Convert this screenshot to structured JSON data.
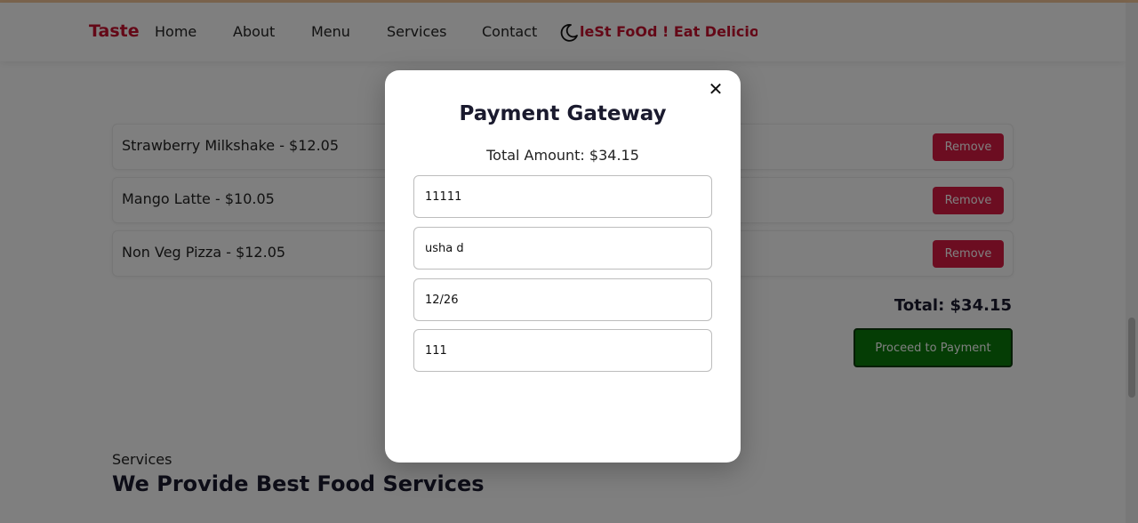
{
  "nav": {
    "brand": "Taste",
    "links": [
      "Home",
      "About",
      "Menu",
      "Services",
      "Contact"
    ],
    "tagline": "leSt FoOd ! Eat Delicious"
  },
  "cart": {
    "items": [
      {
        "label": "Strawberry Milkshake - $12.05",
        "remove_label": "Remove"
      },
      {
        "label": "Mango Latte - $10.05",
        "remove_label": "Remove"
      },
      {
        "label": "Non Veg Pizza - $12.05",
        "remove_label": "Remove"
      }
    ],
    "total": "Total: $34.15",
    "proceed_label": "Proceed to Payment"
  },
  "services": {
    "label": "Services",
    "heading": "We Provide Best Food Services"
  },
  "modal": {
    "close_glyph": "✕",
    "title": "Payment Gateway",
    "amount": "Total Amount: $34.15",
    "fields": {
      "card_number": "11111",
      "name": "usha d",
      "expiry": "12/26",
      "cvv": "111"
    }
  },
  "colors": {
    "brand": "#c8102e",
    "remove": "#d81b43",
    "proceed": "#0a7a0a"
  },
  "icons": {
    "theme_toggle": "moon-icon",
    "close": "close-icon"
  }
}
